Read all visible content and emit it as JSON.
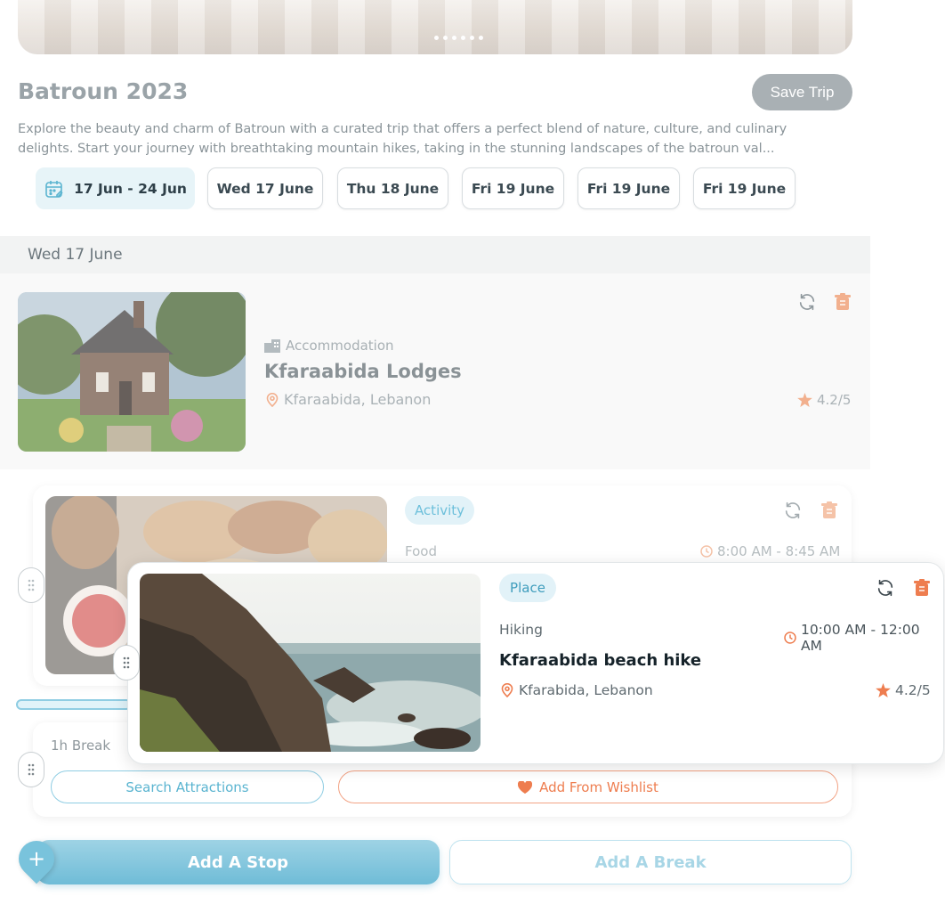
{
  "hero": {
    "slide_count": 6
  },
  "trip": {
    "title": "Batroun 2023",
    "save_label": "Save Trip",
    "description": "Explore the beauty and charm of Batroun with a curated trip that offers a perfect blend of nature, culture, and culinary delights. Start your journey with breathtaking mountain hikes, taking in the stunning landscapes of the batroun val..."
  },
  "date_chips": {
    "range": "17 Jun - 24 Jun",
    "days": [
      "Wed 17 June",
      "Thu 18 June",
      "Fri 19 June",
      "Fri 19 June",
      "Fri 19 June"
    ]
  },
  "day_header": "Wed 17 June",
  "accommodation": {
    "type": "Accommodation",
    "name": "Kfaraabida Lodges",
    "location": "Kfaraabida, Lebanon",
    "rating": "4.2/5"
  },
  "food_stop": {
    "badge": "Activity",
    "category": "Food",
    "time": "8:00 AM - 8:45 AM"
  },
  "place_stop": {
    "badge": "Place",
    "category": "Hiking",
    "time": "10:00 AM - 12:00 AM",
    "name": "Kfaraabida beach hike",
    "location": "Kfarabida, Lebanon",
    "rating": "4.2/5"
  },
  "break_block": {
    "label": "1h Break",
    "search_label": "Search Attractions",
    "wishlist_label": "Add From Wishlist"
  },
  "actions": {
    "add_stop": "Add A Stop",
    "add_break": "Add A Break",
    "fab_symbol": "+"
  },
  "colors": {
    "accent_blue": "#6fbcd7",
    "accent_orange": "#ee7d4f",
    "badge_bg": "#e2f2f8",
    "muted_text": "#8a9499"
  },
  "icons": [
    "calendar-icon",
    "building-icon",
    "location-pin-icon",
    "star-icon",
    "refresh-icon",
    "trash-icon",
    "clock-icon",
    "drag-handle-icon",
    "heart-icon",
    "plus-icon"
  ]
}
